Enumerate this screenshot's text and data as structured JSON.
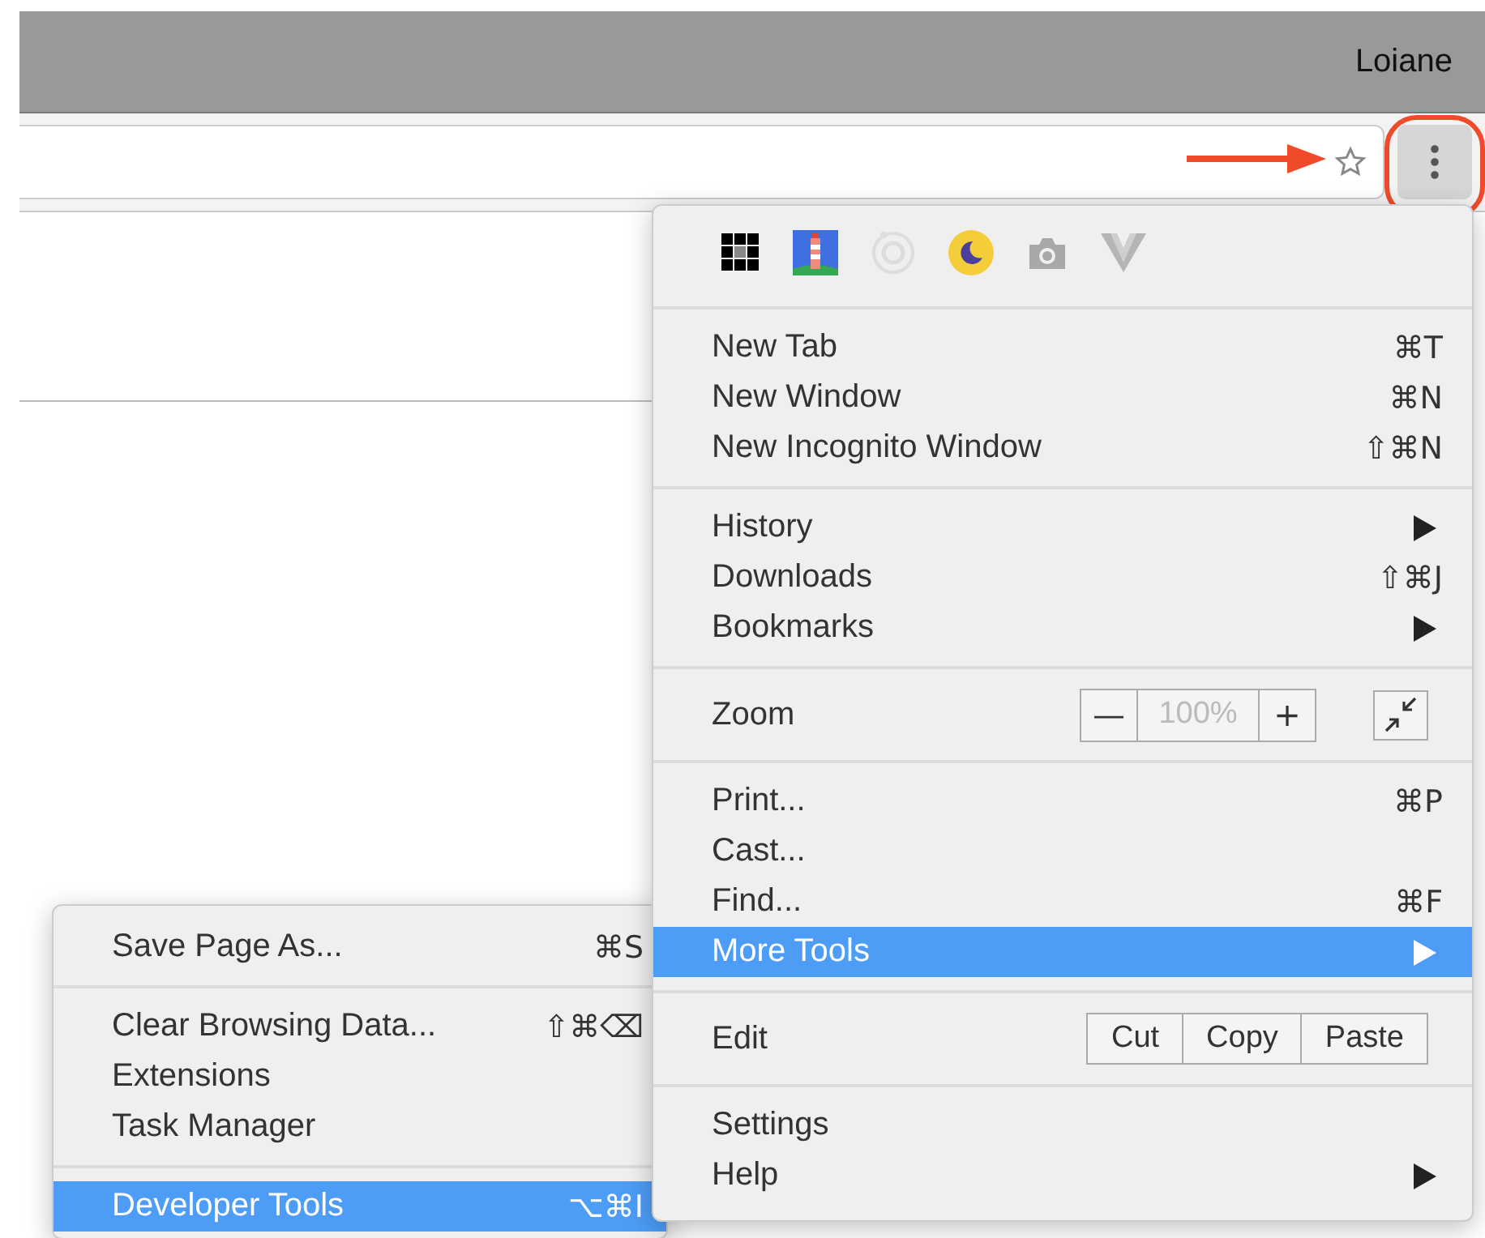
{
  "window": {
    "user_name": "Loiane"
  },
  "menu": {
    "sections": [
      [
        {
          "kind": "item",
          "label": "New Tab",
          "shortcut": "⌘T",
          "submenu": false,
          "selected": false
        },
        {
          "kind": "item",
          "label": "New Window",
          "shortcut": "⌘N",
          "submenu": false,
          "selected": false
        },
        {
          "kind": "item",
          "label": "New Incognito Window",
          "shortcut": "⇧⌘N",
          "submenu": false,
          "selected": false
        }
      ],
      [
        {
          "kind": "item",
          "label": "History",
          "submenu": true,
          "selected": false
        },
        {
          "kind": "item",
          "label": "Downloads",
          "shortcut": "⇧⌘J",
          "submenu": false,
          "selected": false
        },
        {
          "kind": "item",
          "label": "Bookmarks",
          "submenu": true,
          "selected": false
        }
      ],
      [
        {
          "kind": "zoom",
          "label": "Zoom",
          "minus": "—",
          "value": "100%",
          "plus": "+"
        }
      ],
      [
        {
          "kind": "item",
          "label": "Print...",
          "shortcut": "⌘P",
          "submenu": false,
          "selected": false
        },
        {
          "kind": "item",
          "label": "Cast...",
          "submenu": false,
          "selected": false
        },
        {
          "kind": "item",
          "label": "Find...",
          "shortcut": "⌘F",
          "submenu": false,
          "selected": false
        },
        {
          "kind": "item",
          "label": "More Tools",
          "submenu": true,
          "selected": true
        }
      ],
      [
        {
          "kind": "edit",
          "label": "Edit",
          "buttons": [
            "Cut",
            "Copy",
            "Paste"
          ]
        }
      ],
      [
        {
          "kind": "item",
          "label": "Settings",
          "submenu": false,
          "selected": false
        },
        {
          "kind": "item",
          "label": "Help",
          "submenu": true,
          "selected": false
        }
      ]
    ]
  },
  "submenu": {
    "sections": [
      [
        {
          "label": "Save Page As...",
          "shortcut": "⌘S",
          "selected": false
        }
      ],
      [
        {
          "label": "Clear Browsing Data...",
          "shortcut": "⇧⌘⌫",
          "selected": false
        },
        {
          "label": "Extensions",
          "selected": false
        },
        {
          "label": "Task Manager",
          "selected": false
        }
      ],
      [
        {
          "label": "Developer Tools",
          "shortcut": "⌥⌘I",
          "selected": true
        }
      ]
    ]
  }
}
